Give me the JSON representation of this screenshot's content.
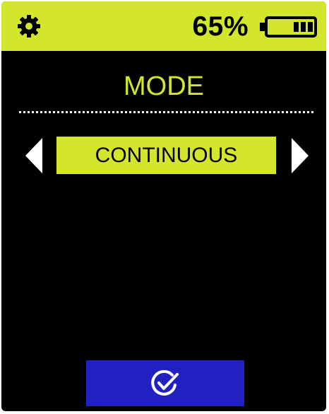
{
  "status_bar": {
    "settings_icon": "gear-icon",
    "battery_percent": "65%",
    "battery_icon": "battery-icon",
    "battery_level_bars": 3,
    "background_color": "#d4e62c"
  },
  "screen": {
    "title": "MODE",
    "selected_mode": "CONTINUOUS",
    "prev_icon": "arrow-left-icon",
    "next_icon": "arrow-right-icon",
    "accent_color": "#d4e62c"
  },
  "confirm": {
    "icon": "check-circle-icon",
    "background_color": "#2021c0"
  }
}
